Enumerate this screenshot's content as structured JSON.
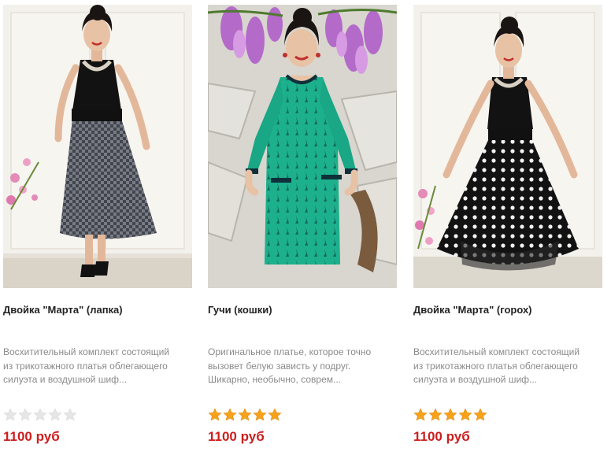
{
  "products": [
    {
      "title": "Двойка \"Марта\" (лапка)",
      "description": [
        "Восхитительный комплект состоящий",
        "из трикотажного платья облегающего",
        "силуэта и воздушной шиф..."
      ],
      "rating": 0,
      "max_rating": 5,
      "price": "1100 руб",
      "photo_icon": "woman-black-top-houndstooth-skirt"
    },
    {
      "title": "Гучи (кошки)",
      "description": [
        "Оригинальное платье, которое точно",
        "вызовет белую зависть у подруг.",
        "Шикарно, необычно, соврем..."
      ],
      "rating": 5,
      "max_rating": 5,
      "price": "1100 руб",
      "photo_icon": "woman-green-cat-print-dress"
    },
    {
      "title": "Двойка \"Марта\" (горох)",
      "description": [
        "Восхитительный комплект состоящий",
        "из трикотажного платья облегающего",
        "силуэта и воздушной шиф..."
      ],
      "rating": 5,
      "max_rating": 5,
      "price": "1100 руб",
      "photo_icon": "woman-black-top-polka-dot-skirt"
    }
  ],
  "colors": {
    "price": "#cc1f1f",
    "star_filled": "#f6a21a",
    "star_empty": "#e6e6e6",
    "title": "#222222",
    "description": "#8a8a8a"
  }
}
